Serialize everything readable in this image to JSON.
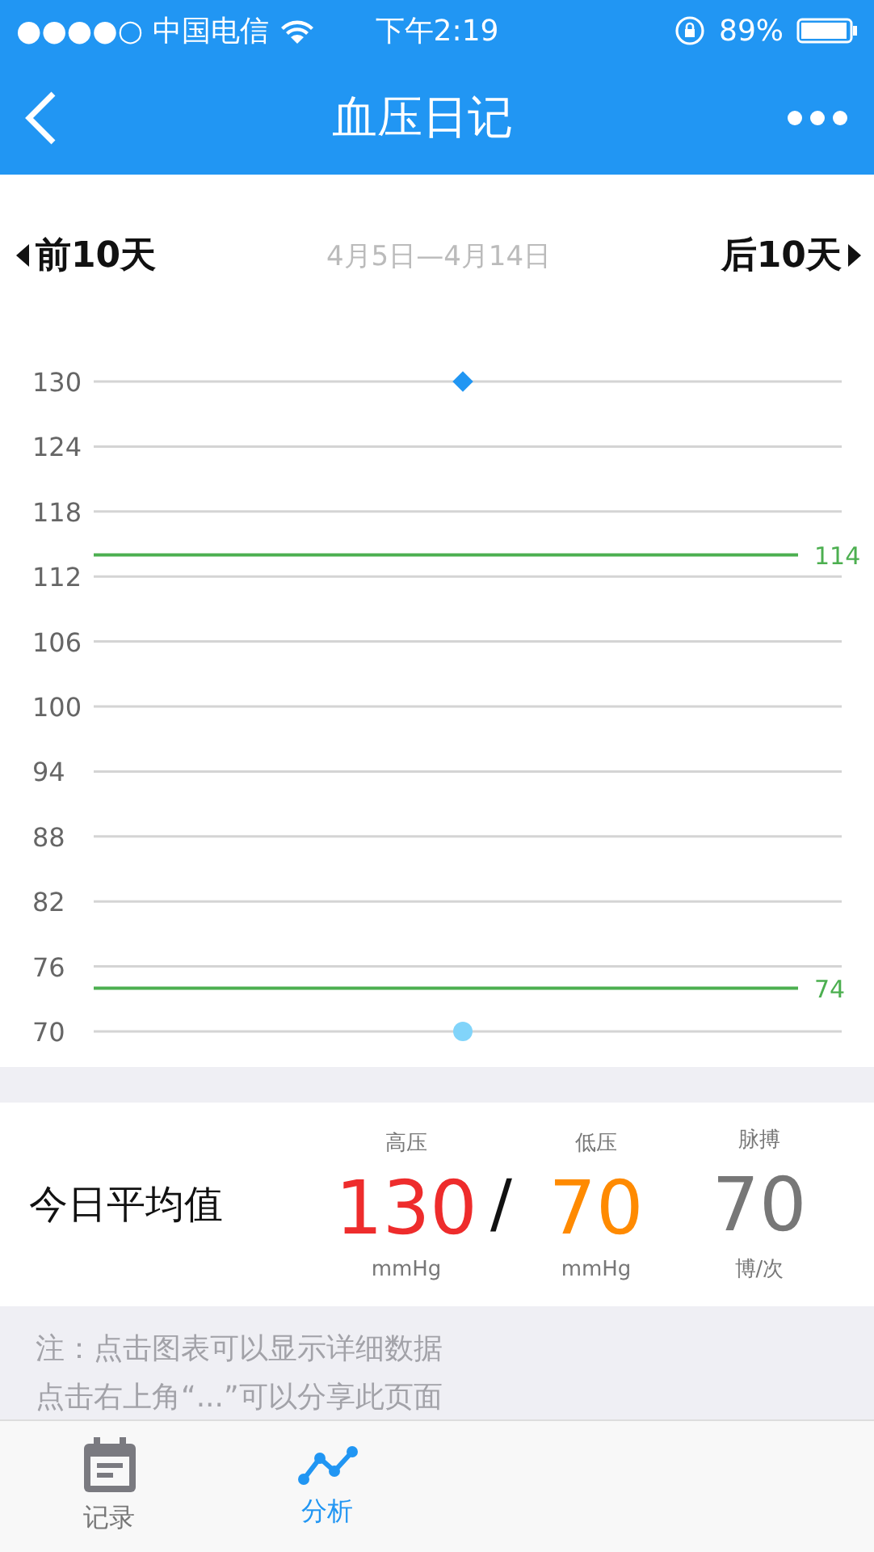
{
  "status_bar": {
    "carrier": "●●●●○ 中国电信",
    "time": "下午2:19",
    "battery": "89%"
  },
  "nav": {
    "title": "血压日记"
  },
  "range": {
    "prev": "前10天",
    "label": "4月5日—4月14日",
    "next": "后10天"
  },
  "chart_data": {
    "type": "scatter",
    "categories": [
      null
    ],
    "yticks": [
      70,
      76,
      82,
      88,
      94,
      100,
      106,
      112,
      118,
      124,
      130
    ],
    "ylim": [
      70,
      130
    ],
    "series": [
      {
        "color": "#2196f3",
        "values": [
          130
        ]
      },
      {
        "color": "#81d4fa",
        "values": [
          70
        ]
      }
    ],
    "grid": true,
    "ref_lines": [
      {
        "axis": "y",
        "value": 114,
        "label": "114",
        "color": "#4caf50"
      },
      {
        "axis": "y",
        "value": 74,
        "label": "74",
        "color": "#4caf50"
      }
    ]
  },
  "summary": {
    "title": "今日平均值",
    "separator": "/",
    "metrics": [
      {
        "label": "高压",
        "value": "130",
        "unit": "mmHg",
        "color": "#ee2c2c"
      },
      {
        "label": "低压",
        "value": "70",
        "unit": "mmHg",
        "color": "#ff8a00"
      },
      {
        "label": "脉搏",
        "value": "70",
        "unit": "博/次",
        "color": "#777777"
      }
    ]
  },
  "notes": [
    "注：点击图表可以显示详细数据",
    "点击右上角“...”可以分享此页面"
  ],
  "tabs": [
    {
      "label": "记录",
      "kind": "calendar",
      "selected": false
    },
    {
      "label": "分析",
      "kind": "trend",
      "selected": true
    }
  ]
}
